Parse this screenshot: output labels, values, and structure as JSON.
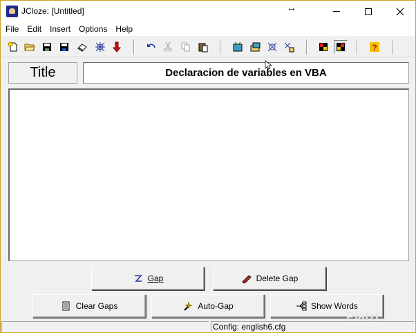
{
  "window": {
    "title": "JCloze: [Untitled]",
    "buttons": {
      "minimize": "—",
      "maximize": "☐",
      "close": "✕"
    },
    "resize_arrow": "↔"
  },
  "menu": [
    "File",
    "Edit",
    "Insert",
    "Options",
    "Help"
  ],
  "toolbar": {
    "icons": [
      "new-file-icon",
      "open-folder-icon",
      "save-icon",
      "save-as-icon",
      "eraser-icon",
      "web-icon",
      "down-arrow-icon",
      "undo-icon",
      "cut-icon",
      "copy-icon",
      "paste-icon",
      "export-web-1-icon",
      "export-web-2-icon",
      "export-web-3-icon",
      "export-web-4-icon",
      "config-icon",
      "config-active-icon",
      "help-icon"
    ]
  },
  "title_row": {
    "label": "Title",
    "value": "Declaracion de variables en VBA"
  },
  "editor": {
    "text": ""
  },
  "buttons": {
    "gap": "Gap",
    "delete_gap": "Delete Gap",
    "clear_gaps": "Clear Gaps",
    "auto_gap": "Auto-Gap",
    "show_words": "Show Words"
  },
  "status": {
    "left": "",
    "config": "Config: english6.cfg"
  },
  "watermark": "Platzi",
  "colors": {
    "frame": "#c9a227",
    "face": "#f0f0f0",
    "help": "#f2c200"
  }
}
